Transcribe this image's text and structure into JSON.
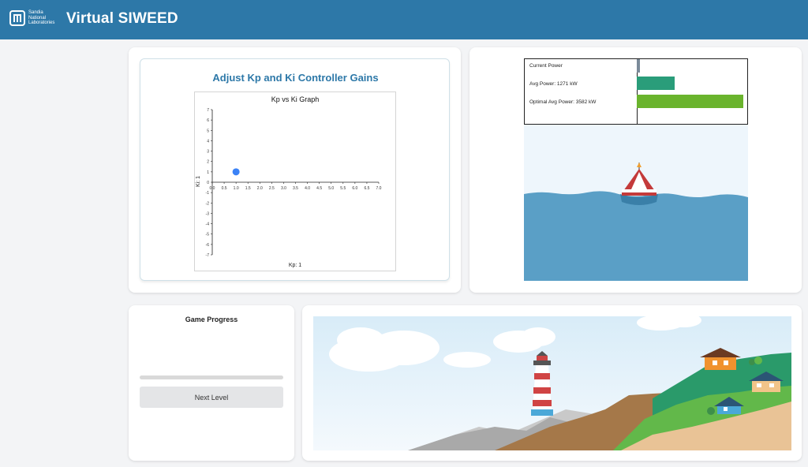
{
  "header": {
    "logo_lines": [
      "Sandia",
      "National",
      "Laboratories"
    ],
    "title": "Virtual SIWEED"
  },
  "gains": {
    "title": "Adjust Kp and Ki Controller Gains"
  },
  "chart_data": {
    "type": "scatter",
    "title": "Kp vs Ki Graph",
    "xlabel": "Kp: 1",
    "ylabel": "Ki: 1",
    "xlim": [
      0,
      7
    ],
    "ylim": [
      -7,
      7
    ],
    "x_ticks": [
      "0.0",
      "0.5",
      "1.0",
      "1.5",
      "2.0",
      "2.5",
      "3.0",
      "3.5",
      "4.0",
      "4.5",
      "5.0",
      "5.5",
      "6.0",
      "6.5",
      "7.0"
    ],
    "y_ticks": [
      "7",
      "6",
      "5",
      "4",
      "3",
      "2",
      "1",
      "0",
      "-1",
      "-2",
      "-3",
      "-4",
      "-5",
      "-6",
      "-7"
    ],
    "points": [
      {
        "x": 1,
        "y": 1
      }
    ],
    "point_color": "#3b82f6",
    "grid": false
  },
  "power": {
    "rows": [
      {
        "label": "Current Power",
        "value": 40,
        "color": "#7a8a99"
      },
      {
        "label": "Avg Power: 1271 kW",
        "value": 1271,
        "color": "#2a9d7a"
      },
      {
        "label": "Optimal Avg Power: 3582 kW",
        "value": 3582,
        "color": "#6ab42d"
      }
    ],
    "max": 3582
  },
  "progress": {
    "title": "Game Progress",
    "fraction": 0,
    "next_label": "Next Level"
  },
  "colors": {
    "header": "#2d78a8",
    "ocean": "#5a9fc6",
    "sky": "#eef6fc"
  }
}
